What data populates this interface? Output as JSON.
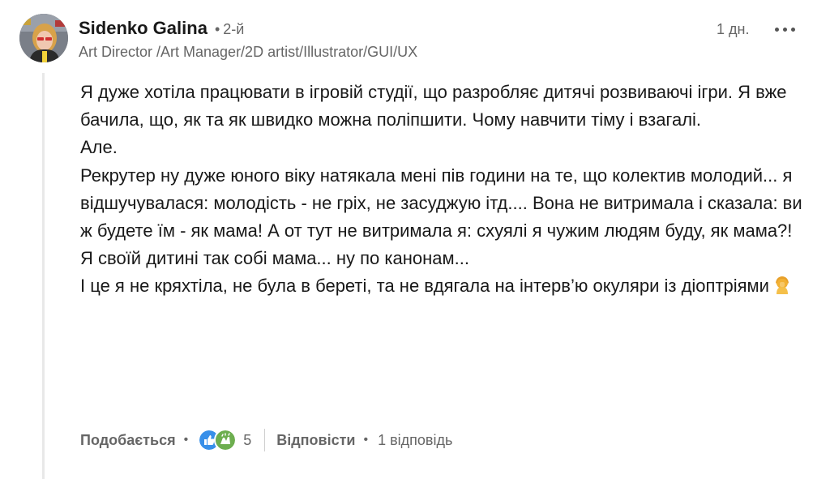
{
  "comment": {
    "author": {
      "name": "Sidenko Galina",
      "degree": "2-й",
      "headline": "Art Director /Art Manager/2D artist/Illustrator/GUI/UX"
    },
    "separator": "•",
    "timestamp": "1 дн.",
    "more_icon": "more-horizontal-icon",
    "body": [
      "Я дуже хотіла працювати в ігровій студії, що разробляє дитячі розвиваючі ігри. Я вже бачила, що, як та як швидко можна поліпшити. Чому навчити тіму і взагалі.",
      "Але.",
      "Рекрутер ну дуже юного віку натякала мені пів години на те, що колектив молодий... я відшучувалася: молодість - не гріх, не засуджую ітд.... Вона не витримала і сказала: ви ж будете їм - як мама! А от тут не витримала я: схуялі я чужим людям буду, як мама?! Я своїй дитині так собі мама... ну по канонам...",
      "І це я не кряхтіла, не була в береті, та не вдягала на інтерв’ю окуляри із діоптріями"
    ],
    "body_end_emoji": "face-palm-emoji",
    "actions": {
      "like_label": "Подобається",
      "reaction_icons": [
        "like-reaction-icon",
        "celebrate-reaction-icon"
      ],
      "reaction_count": "5",
      "reply_label": "Відповісти",
      "replies_count": "1 відповідь"
    }
  },
  "colors": {
    "text_primary": "#191919",
    "text_secondary": "#666666",
    "like_blue": "#378fe9",
    "celebrate_green": "#44712e",
    "thread_line": "#e8e8e8"
  }
}
